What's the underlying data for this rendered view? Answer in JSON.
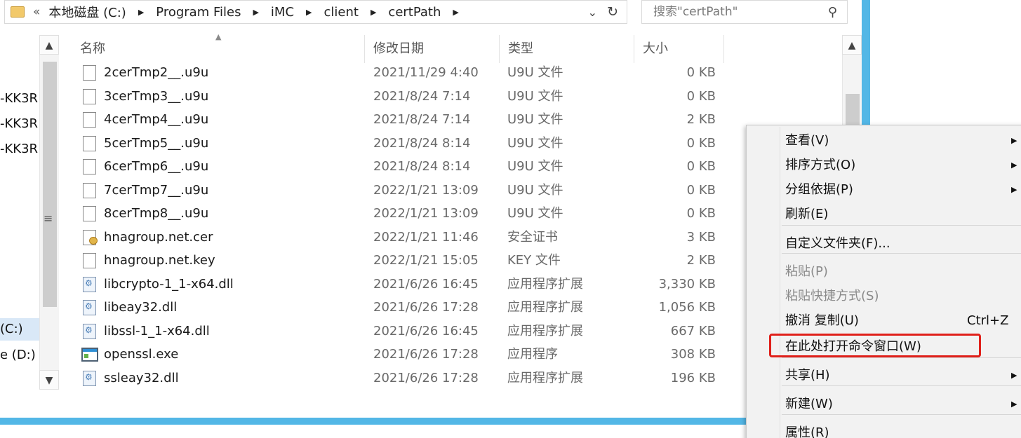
{
  "address_bar": {
    "nav_back": "«",
    "breadcrumbs": [
      "本地磁盘 (C:)",
      "Program Files",
      "iMC",
      "client",
      "certPath"
    ],
    "dropdown_glyph": "⌄",
    "refresh_glyph": "↻"
  },
  "search": {
    "placeholder": "搜索\"certPath\"",
    "icon": "search-icon"
  },
  "nav_pane": {
    "items": [
      "-KK3R",
      "-KK3R",
      "-KK3R",
      "(C:)",
      "e (D:) d"
    ],
    "selected_index": 3
  },
  "columns": {
    "name": "名称",
    "date": "修改日期",
    "type": "类型",
    "size": "大小"
  },
  "files": [
    {
      "name": "2cerTmp2__.u9u",
      "date": "2021/11/29 4:40",
      "type": "U9U 文件",
      "size": "0 KB",
      "icon": "file-icon"
    },
    {
      "name": "3cerTmp3__.u9u",
      "date": "2021/8/24 7:14",
      "type": "U9U 文件",
      "size": "0 KB",
      "icon": "file-icon"
    },
    {
      "name": "4cerTmp4__.u9u",
      "date": "2021/8/24 7:14",
      "type": "U9U 文件",
      "size": "2 KB",
      "icon": "file-icon"
    },
    {
      "name": "5cerTmp5__.u9u",
      "date": "2021/8/24 8:14",
      "type": "U9U 文件",
      "size": "0 KB",
      "icon": "file-icon"
    },
    {
      "name": "6cerTmp6__.u9u",
      "date": "2021/8/24 8:14",
      "type": "U9U 文件",
      "size": "0 KB",
      "icon": "file-icon"
    },
    {
      "name": "7cerTmp7__.u9u",
      "date": "2022/1/21 13:09",
      "type": "U9U 文件",
      "size": "0 KB",
      "icon": "file-icon"
    },
    {
      "name": "8cerTmp8__.u9u",
      "date": "2022/1/21 13:09",
      "type": "U9U 文件",
      "size": "0 KB",
      "icon": "file-icon"
    },
    {
      "name": "hnagroup.net.cer",
      "date": "2022/1/21 11:46",
      "type": "安全证书",
      "size": "3 KB",
      "icon": "certificate-icon"
    },
    {
      "name": "hnagroup.net.key",
      "date": "2022/1/21 15:05",
      "type": "KEY 文件",
      "size": "2 KB",
      "icon": "file-icon"
    },
    {
      "name": "libcrypto-1_1-x64.dll",
      "date": "2021/6/26 16:45",
      "type": "应用程序扩展",
      "size": "3,330 KB",
      "icon": "dll-icon"
    },
    {
      "name": "libeay32.dll",
      "date": "2021/6/26 17:28",
      "type": "应用程序扩展",
      "size": "1,056 KB",
      "icon": "dll-icon"
    },
    {
      "name": "libssl-1_1-x64.dll",
      "date": "2021/6/26 16:45",
      "type": "应用程序扩展",
      "size": "667 KB",
      "icon": "dll-icon"
    },
    {
      "name": "openssl.exe",
      "date": "2021/6/26 17:28",
      "type": "应用程序",
      "size": "308 KB",
      "icon": "exe-icon"
    },
    {
      "name": "ssleay32.dll",
      "date": "2021/6/26 17:28",
      "type": "应用程序扩展",
      "size": "196 KB",
      "icon": "dll-icon"
    }
  ],
  "context_menu": {
    "items": [
      {
        "label": "查看(V)",
        "submenu": true
      },
      {
        "label": "排序方式(O)",
        "submenu": true
      },
      {
        "label": "分组依据(P)",
        "submenu": true
      },
      {
        "label": "刷新(E)"
      },
      {
        "label": "自定义文件夹(F)..."
      },
      {
        "label": "粘贴(P)",
        "disabled": true
      },
      {
        "label": "粘贴快捷方式(S)",
        "disabled": true
      },
      {
        "label": "撤消 复制(U)",
        "shortcut": "Ctrl+Z"
      },
      {
        "label": "在此处打开命令窗口(W)",
        "highlighted": true
      },
      {
        "label": "共享(H)",
        "submenu": true
      },
      {
        "label": "新建(W)",
        "submenu": true
      },
      {
        "label": "属性(R)"
      }
    ],
    "submenu_glyph": "▶",
    "highlight_color": "#e0201a"
  }
}
